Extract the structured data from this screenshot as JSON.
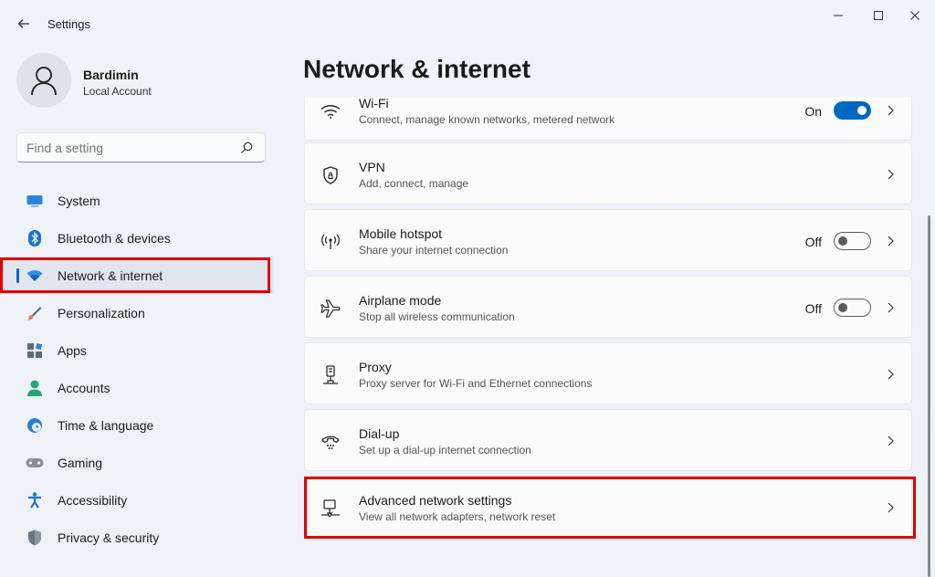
{
  "window": {
    "title": "Settings",
    "back": "←",
    "minimize": "—",
    "maximize": "☐",
    "close": "✕"
  },
  "profile": {
    "name": "Bardimin",
    "account_type": "Local Account"
  },
  "search": {
    "placeholder": "Find a setting",
    "value": ""
  },
  "sidebar": {
    "items": [
      {
        "label": "System",
        "icon": "monitor-icon",
        "color": "#2b86d6"
      },
      {
        "label": "Bluetooth & devices",
        "icon": "bluetooth-icon",
        "color": "#1c74c7"
      },
      {
        "label": "Network & internet",
        "icon": "wifi-icon",
        "color": "#2f8fe3",
        "active": true
      },
      {
        "label": "Personalization",
        "icon": "brush-icon",
        "color": "#e8734a"
      },
      {
        "label": "Apps",
        "icon": "apps-icon",
        "color": "#5c6b7a"
      },
      {
        "label": "Accounts",
        "icon": "person-icon",
        "color": "#2aa37a"
      },
      {
        "label": "Time & language",
        "icon": "globe-clock-icon",
        "color": "#2a7fc9"
      },
      {
        "label": "Gaming",
        "icon": "gamepad-icon",
        "color": "#8a8f96"
      },
      {
        "label": "Accessibility",
        "icon": "accessibility-icon",
        "color": "#1c74c7"
      },
      {
        "label": "Privacy & security",
        "icon": "shield-icon",
        "color": "#6c7580"
      }
    ]
  },
  "page": {
    "title": "Network & internet"
  },
  "settings": [
    {
      "title": "Wi-Fi",
      "subtitle": "Connect, manage known networks, metered network",
      "icon": "wifi-icon",
      "state": "On",
      "toggle": true
    },
    {
      "title": "VPN",
      "subtitle": "Add, connect, manage",
      "icon": "vpn-shield-icon"
    },
    {
      "title": "Mobile hotspot",
      "subtitle": "Share your internet connection",
      "icon": "hotspot-icon",
      "state": "Off",
      "toggle": false
    },
    {
      "title": "Airplane mode",
      "subtitle": "Stop all wireless communication",
      "icon": "airplane-icon",
      "state": "Off",
      "toggle": false
    },
    {
      "title": "Proxy",
      "subtitle": "Proxy server for Wi-Fi and Ethernet connections",
      "icon": "proxy-icon"
    },
    {
      "title": "Dial-up",
      "subtitle": "Set up a dial-up internet connection",
      "icon": "phone-icon"
    },
    {
      "title": "Advanced network settings",
      "subtitle": "View all network adapters, network reset",
      "icon": "network-adapter-icon"
    }
  ],
  "colors": {
    "accent": "#0067c0",
    "highlight_box": "#e00000"
  }
}
